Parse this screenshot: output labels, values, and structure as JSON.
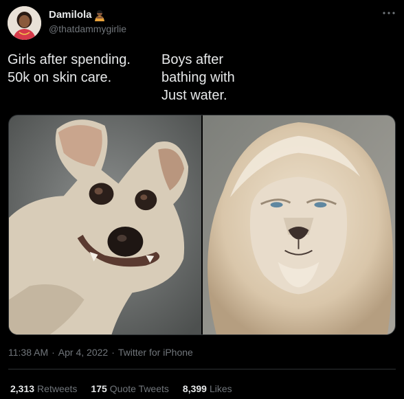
{
  "author": {
    "display_name": "Damilola",
    "handle": "@thatdammygirlie"
  },
  "tweet": {
    "text_left": "Girls after spending.\n50k on skin care.",
    "text_right": "Boys after\nbathing with\nJust water."
  },
  "meta": {
    "time": "11:38 AM",
    "dot1": "·",
    "date": "Apr 4, 2022",
    "dot2": "·",
    "source": "Twitter for iPhone"
  },
  "stats": {
    "retweets_count": "2,313",
    "retweets_label": "Retweets",
    "quotes_count": "175",
    "quotes_label": "Quote Tweets",
    "likes_count": "8,399",
    "likes_label": "Likes"
  },
  "icons": {
    "more": "more-horizontal-icon",
    "emoji": "person-bowing-emoji-icon"
  },
  "colors": {
    "background": "#000000",
    "text_primary": "#e7e9ea",
    "text_secondary": "#71767b",
    "divider": "#2f3336"
  }
}
